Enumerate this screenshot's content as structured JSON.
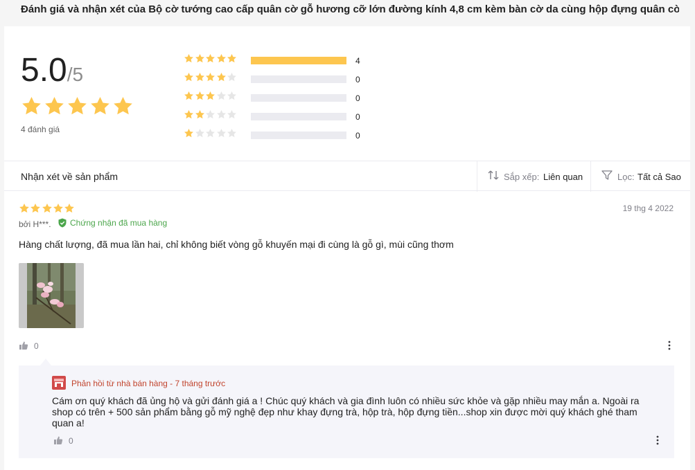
{
  "page_title": "Đánh giá và nhận xét của Bộ cờ tướng cao cấp quân cờ gỗ hương cỡ lớn đường kính 4,8 cm kèm bàn cờ da cùng hộp đựng quân cờ ...",
  "summary": {
    "average": "5.0",
    "out_of": "/5",
    "average_stars": 5,
    "review_count_text": "4 đánh giá",
    "distribution": [
      {
        "stars": 5,
        "count": "4",
        "fraction": 1.0
      },
      {
        "stars": 4,
        "count": "0",
        "fraction": 0
      },
      {
        "stars": 3,
        "count": "0",
        "fraction": 0
      },
      {
        "stars": 2,
        "count": "0",
        "fraction": 0
      },
      {
        "stars": 1,
        "count": "0",
        "fraction": 0
      }
    ]
  },
  "filter_bar": {
    "label": "Nhận xét về sản phẩm",
    "sort_key": "Sắp xếp:",
    "sort_value": "Liên quan",
    "filter_key": "Lọc:",
    "filter_value": "Tất cả Sao",
    "sort_icon": "sort-arrows-icon",
    "filter_icon": "funnel-icon"
  },
  "review": {
    "stars": 5,
    "date": "19 thg 4 2022",
    "author": "bởi H***.",
    "verified_text": "Chứng nhận đã mua hàng",
    "text": "Hàng chất lượng, đã mua lần hai, chỉ không biết vòng gỗ khuyến mại đi cùng là gỗ gì, mùi cũng thơm",
    "likes": "0",
    "reply": {
      "title": "Phản hồi từ nhà bán hàng - 7 tháng trước",
      "body": "Cám ơn quý khách đã ủng hộ và gửi đánh giá a ! Chúc quý khách và gia đình luôn có nhiều sức khỏe và gặp nhiều may mắn a. Ngoài ra shop có trên + 500 sản phẩm bằng gỗ mỹ nghệ đẹp như khay đựng trà, hộp trà, hộp đựng tiền...shop xin được mời quý khách ghé tham quan a!",
      "likes": "0"
    }
  },
  "colors": {
    "star_filled": "#fdc64f",
    "star_empty": "#e6e6e6",
    "verified": "#4ca64c",
    "reply_title": "#c1442d"
  }
}
